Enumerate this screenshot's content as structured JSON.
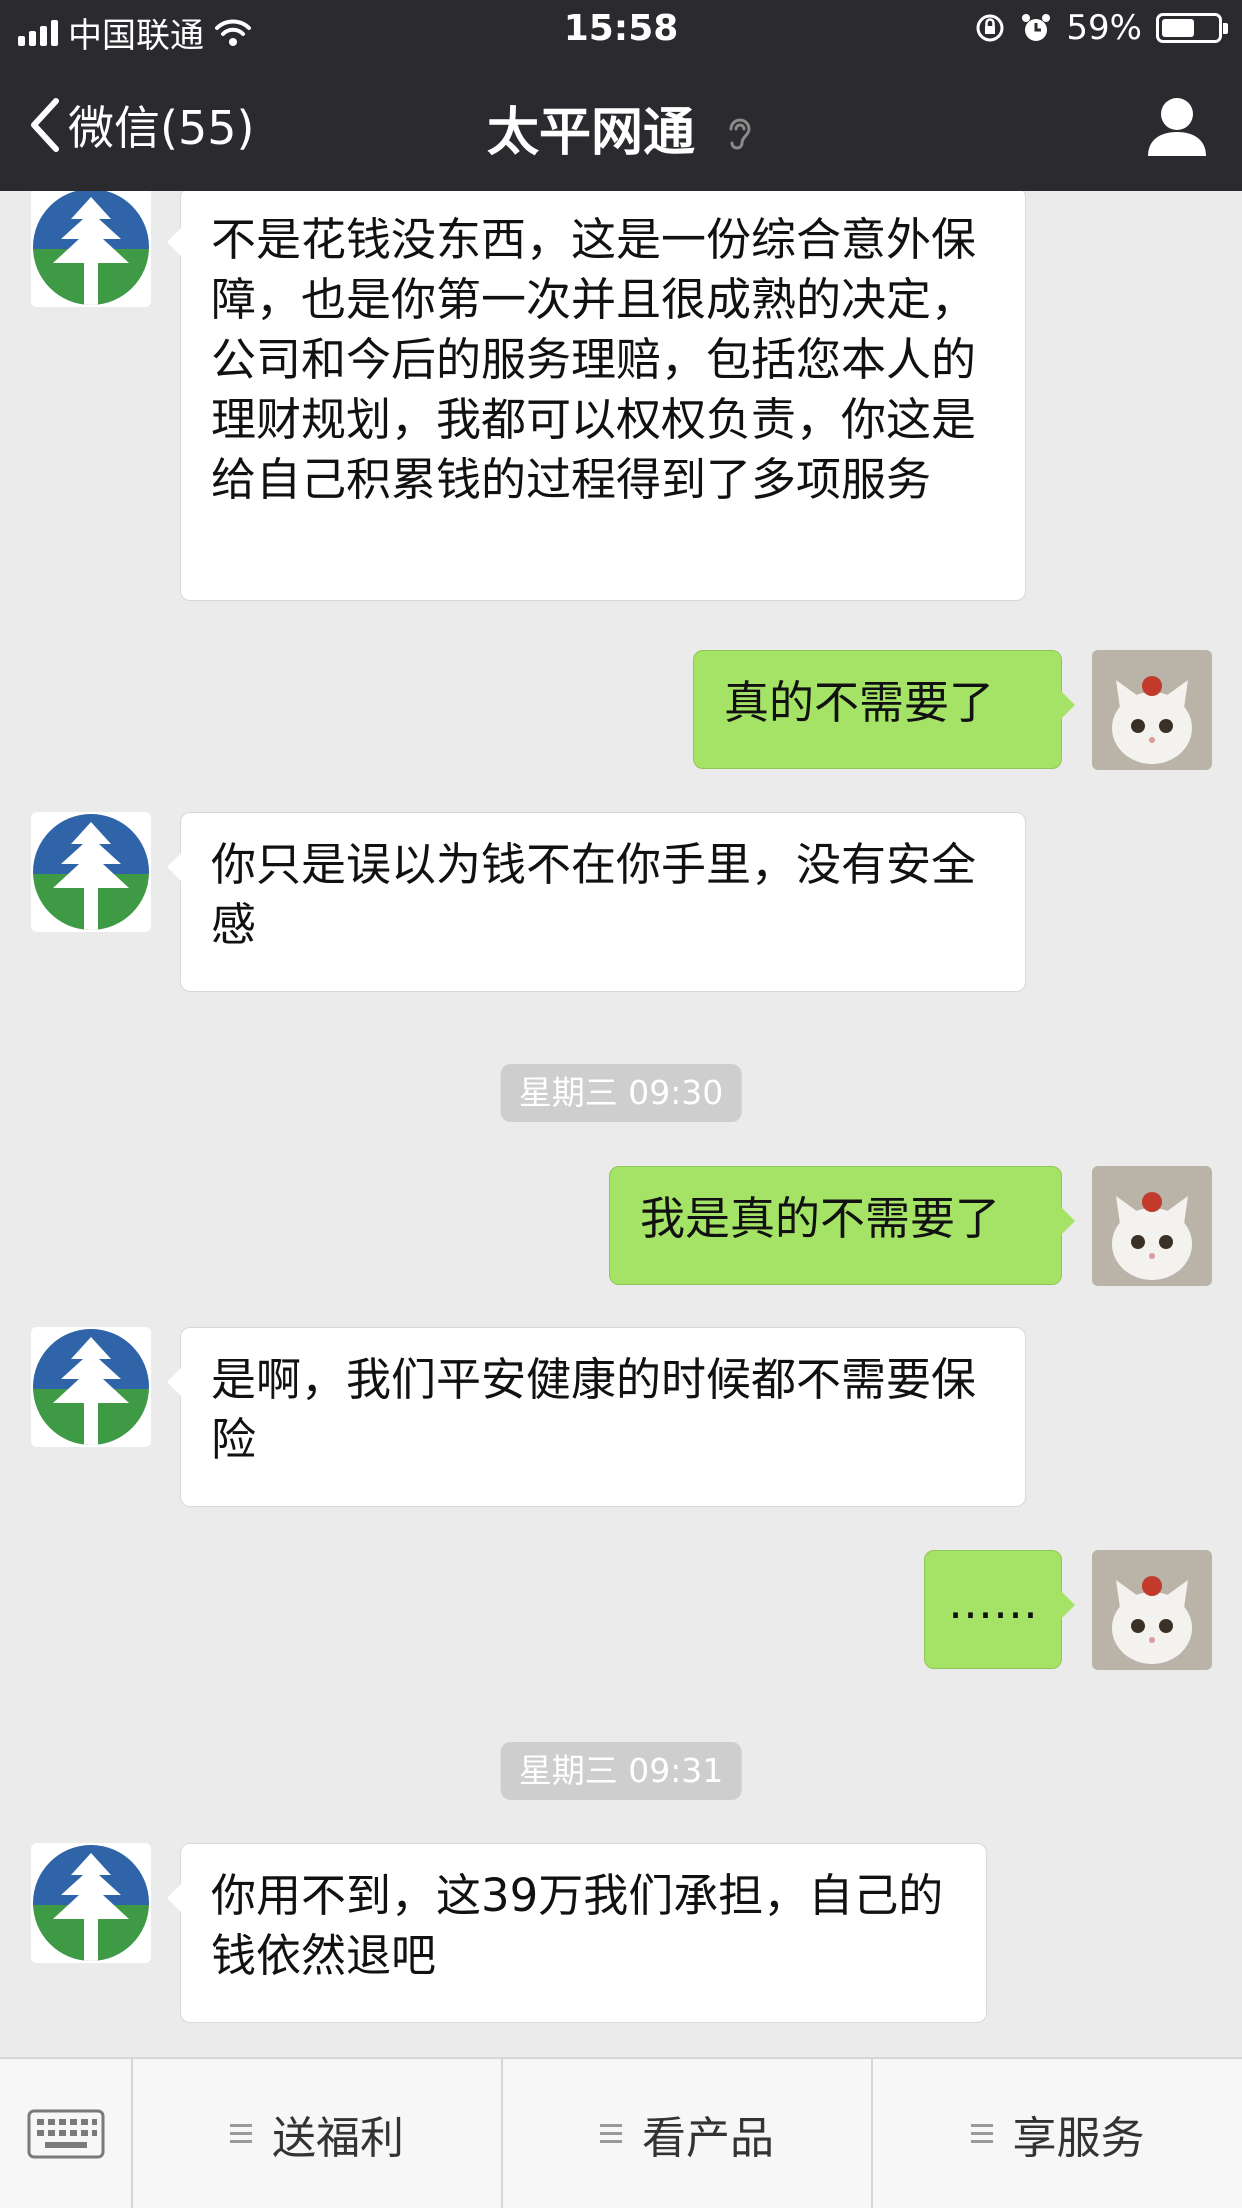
{
  "status_bar": {
    "carrier": "中国联通",
    "time": "15:58",
    "battery": "59%",
    "battery_level": 0.59
  },
  "nav": {
    "back_label": "微信(55)",
    "title": "太平网通"
  },
  "messages": [
    {
      "side": "in",
      "text": "不是花钱没东西，这是一份综合意外保障，也是你第一次并且很成熟的决定，公司和今后的服务理赔，包括您本人的理财规划，我都可以权权负责，你这是给自己积累钱的过程得到了多项服务"
    },
    {
      "side": "out",
      "text": "真的不需要了"
    },
    {
      "side": "in",
      "text": "你只是误以为钱不在你手里，没有安全感"
    },
    {
      "side": "time",
      "text": "星期三 09:30"
    },
    {
      "side": "out",
      "text": "我是真的不需要了"
    },
    {
      "side": "in",
      "text": "是啊，我们平安健康的时候都不需要保险"
    },
    {
      "side": "out",
      "text": "……"
    },
    {
      "side": "time",
      "text": "星期三 09:31"
    },
    {
      "side": "in",
      "text": "你用不到，这39万我们承担，自己的钱依然退吧"
    }
  ],
  "bottom_menu": {
    "items": [
      {
        "label": "送福利"
      },
      {
        "label": "看产品"
      },
      {
        "label": "享服务"
      }
    ]
  },
  "colors": {
    "nav_bg": "#2b2b2f",
    "chat_bg": "#ebebeb",
    "outgoing_bubble": "#a5e366",
    "incoming_bubble": "#ffffff"
  }
}
